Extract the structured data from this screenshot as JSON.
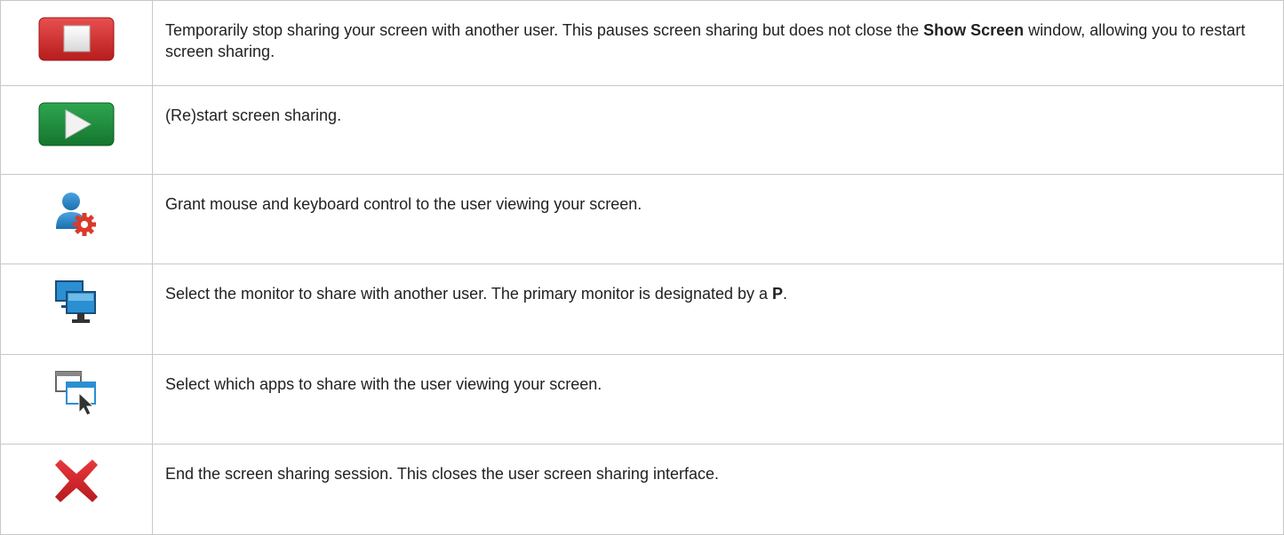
{
  "rows": [
    {
      "icon": "stop-icon",
      "text_before": "Temporarily stop sharing your screen with another user. This pauses screen sharing but does not close the ",
      "bold": "Show Screen",
      "text_after": " window, allowing you to restart screen sharing."
    },
    {
      "icon": "play-icon",
      "text": "(Re)start screen sharing."
    },
    {
      "icon": "user-gear-icon",
      "text": "Grant mouse and keyboard control to the user viewing your screen."
    },
    {
      "icon": "multi-monitor-icon",
      "text_before": "Select the monitor to share with another user. The primary monitor is designated by a ",
      "bold": "P",
      "text_after": "."
    },
    {
      "icon": "app-window-cursor-icon",
      "text": "Select which apps to share with the user viewing your screen."
    },
    {
      "icon": "close-x-icon",
      "text": "End the screen sharing session. This closes the user screen sharing interface."
    }
  ],
  "colors": {
    "stop": "#d42a2a",
    "play": "#1f8a3c",
    "user": "#2c86c8",
    "gear": "#d93a2a",
    "monitor": "#2b8fd3",
    "close": "#d8262b"
  }
}
